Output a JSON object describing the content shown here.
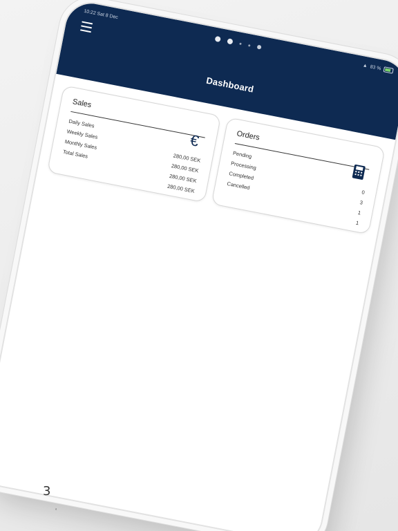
{
  "status_bar": {
    "time_date": "10:22  Sat 8 Dec",
    "battery_percent": "83 %"
  },
  "app": {
    "title": "Dashboard"
  },
  "sales": {
    "title": "Sales",
    "icon": "euro-icon",
    "rows": [
      {
        "label": "Daily Sales",
        "value": "280,00 SEK"
      },
      {
        "label": "Weekly Sales",
        "value": "280,00 SEK"
      },
      {
        "label": "Monthly Sales",
        "value": "280,00 SEK"
      },
      {
        "label": "Total Sales",
        "value": "280,00 SEK"
      }
    ]
  },
  "orders": {
    "title": "Orders",
    "icon": "card-terminal-icon",
    "rows": [
      {
        "label": "Pending",
        "value": "0"
      },
      {
        "label": "Processing",
        "value": "3"
      },
      {
        "label": "Completed",
        "value": "1"
      },
      {
        "label": "Cancelled",
        "value": "1"
      }
    ]
  },
  "background": {
    "mark": "3"
  },
  "colors": {
    "primary": "#0e2a52",
    "background": "#ffffff",
    "card_border": "#d6d6d6"
  }
}
